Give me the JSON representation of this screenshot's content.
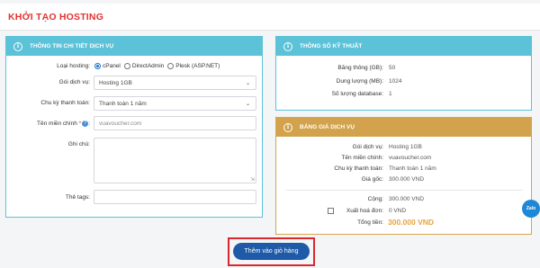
{
  "page": {
    "title": "KHỞI TẠO HOSTING"
  },
  "left_panel": {
    "header": "THÔNG TIN CHI TIẾT DỊCH VỤ",
    "hosting_type": {
      "label": "Loại hosting:",
      "options": [
        "cPanel",
        "DirectAdmin",
        "Plesk (ASP.NET)"
      ],
      "selected": "cPanel"
    },
    "service_package": {
      "label": "Gói dịch vụ:",
      "value": "Hosting 1GB"
    },
    "billing_cycle": {
      "label": "Chu kỳ thanh toán:",
      "value": "Thanh toán 1 năm"
    },
    "domain": {
      "label": "Tên miền chính",
      "required_mark": "*",
      "help": "?",
      "placeholder": "vuavoucher.com"
    },
    "note": {
      "label": "Ghi chú:"
    },
    "tags": {
      "label": "Thẻ tags:"
    }
  },
  "specs_panel": {
    "header": "THÔNG SỐ KỸ THUẬT",
    "rows": [
      {
        "label": "Băng thông (GB):",
        "value": "50"
      },
      {
        "label": "Dung lượng (MB):",
        "value": "1024"
      },
      {
        "label": "Số lượng database:",
        "value": "1"
      }
    ]
  },
  "pricing_panel": {
    "header": "BẢNG GIÁ DỊCH VỤ",
    "rows": [
      {
        "label": "Gói dịch vụ:",
        "value": "Hosting 1GB"
      },
      {
        "label": "Tên miền chính:",
        "value": "vuavoucher.com"
      },
      {
        "label": "Chu kỳ thanh toán:",
        "value": "Thanh toán 1 năm"
      },
      {
        "label": "Giá gốc:",
        "value": "300.000 VND"
      }
    ],
    "subtotal": {
      "label": "Cộng:",
      "value": "300.000 VND"
    },
    "invoice": {
      "label": "Xuất hoá đơn:",
      "value": "0 VND"
    },
    "total": {
      "label": "Tổng tiền:",
      "value": "300.000 VND"
    }
  },
  "cta": {
    "label": "Thêm vào giỏ hàng"
  },
  "float_button": {
    "label": "Zalo"
  },
  "icons": {
    "panel_info": "info-icon",
    "select_chevron": "chevron-down-icon"
  },
  "colors": {
    "title": "#e4332f",
    "panel_teal": "#5bc2d8",
    "panel_gold": "#d2a24c",
    "cta": "#1e5aa8",
    "highlight": "#d9272e",
    "total": "#e8a33d"
  }
}
